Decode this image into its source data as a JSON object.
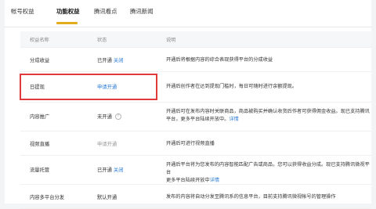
{
  "tabs": [
    {
      "label": "帐号权益"
    },
    {
      "label": "功能权益"
    },
    {
      "label": "腾讯看点"
    },
    {
      "label": "腾讯新闻"
    }
  ],
  "columns": {
    "name": "权益名称",
    "status": "状态",
    "desc": "说明"
  },
  "rows": [
    {
      "name": "分成收益",
      "status": "已开通",
      "action": "关闭",
      "desc": [
        "开通后将根据内容的综合表现获得平台的分成收益"
      ]
    },
    {
      "name": "日提现",
      "status": "申请开通",
      "action": "",
      "desc": [
        "开通后创作者在达到提现门槛时，每日可随时进行余额提现。"
      ]
    },
    {
      "name": "内容推广",
      "status": "未开通",
      "action": "?",
      "desc": [
        "开通后可在发布内容时关联商品，商品被购买并确认收货后作者可获得佣金收益。现已支持腾讯",
        "平台，更多平台陆续开放中。"
      ],
      "desc_link": "详情"
    },
    {
      "name": "视频直播",
      "status": "申请开通",
      "action": "",
      "desc": [
        "开通后可进行视频直播"
      ]
    },
    {
      "name": "流量托管",
      "status": "已开通",
      "action": "关闭",
      "desc": [
        "开通后平台将为您发布的内容智能匹配广告或商品，您可以获得收益分成。现已支持腾讯微视平台",
        "更多平台陆续开放中"
      ],
      "desc_link": "详情"
    },
    {
      "name": "内容多平台分发",
      "status": "默认开通",
      "action": "",
      "desc": [
        "发布的内容将自动分发至腾讯系的信息平台，目前支持腾讯微视帐号的管理操作"
      ]
    }
  ]
}
